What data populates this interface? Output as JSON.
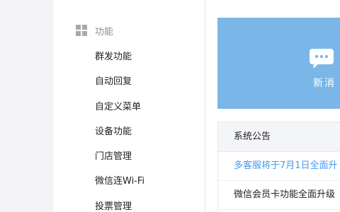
{
  "sidebar": {
    "section_title": "功能",
    "section_icon": "grid-icon",
    "items": [
      {
        "label": "群发功能"
      },
      {
        "label": "自动回复"
      },
      {
        "label": "自定义菜单"
      },
      {
        "label": "设备功能"
      },
      {
        "label": "门店管理"
      },
      {
        "label": "微信连Wi-Fi"
      },
      {
        "label": "投票管理"
      }
    ]
  },
  "banner": {
    "icon": "chat-bubble-icon",
    "text": "新消",
    "background": "#7ab7e8"
  },
  "notice": {
    "title": "系统公告",
    "items": [
      {
        "text": "多客服将于7月1日全面升"
      },
      {
        "text": "微信会员卡功能全面升级"
      }
    ],
    "link_color": "#459ae9"
  }
}
